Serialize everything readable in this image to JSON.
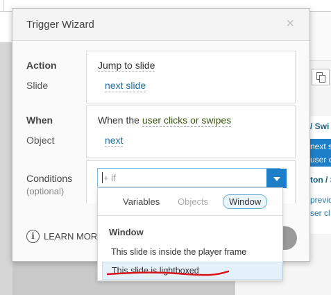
{
  "background": {
    "right_panel": {
      "items": [
        "/ Swi",
        "next s",
        "user cl",
        "ton / S",
        "previo",
        "ser cl"
      ]
    },
    "colors": {
      "canvas": "#c9c9c9",
      "accent": "#1e7fc9"
    }
  },
  "dialog": {
    "title": "Trigger Wizard",
    "close_symbol": "×",
    "action": {
      "label": "Action",
      "value": "Jump to slide",
      "sub_label": "Slide",
      "sub_value": "next slide"
    },
    "when": {
      "label": "When",
      "prefix": "When the",
      "value": "user clicks or swipes",
      "sub_label": "Object",
      "sub_value": "next"
    },
    "conditions": {
      "label": "Conditions",
      "optional": "(optional)",
      "placeholder": "+ if"
    },
    "learn_more": "LEARN MORE",
    "info_icon": "i"
  },
  "dropdown": {
    "tabs": [
      {
        "label": "Variables",
        "state": "normal"
      },
      {
        "label": "Objects",
        "state": "disabled"
      },
      {
        "label": "Window",
        "state": "selected"
      }
    ],
    "section": "Window",
    "items": [
      {
        "label": "This slide is inside the player frame"
      },
      {
        "label": "This slide is lightboxed",
        "highlighted": true
      }
    ],
    "annotation_color": "#d9141b"
  }
}
